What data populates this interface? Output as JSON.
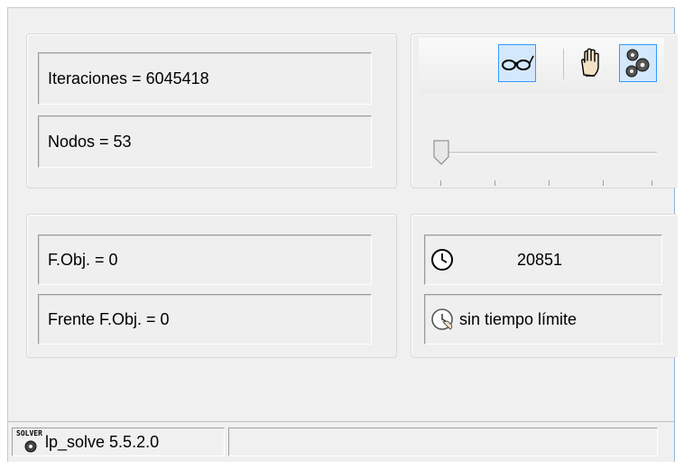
{
  "stats": {
    "iterations": "Iteraciones = 6045418",
    "nodes": "Nodos = 53"
  },
  "objective": {
    "fobj": "F.Obj. = 0",
    "frente_fobj": "Frente F.Obj. = 0"
  },
  "toolbar": {
    "buttons": [
      {
        "icon": "glasses-icon",
        "active": true
      },
      {
        "icon": "hand-icon",
        "active": false
      },
      {
        "icon": "gears-icon",
        "active": true
      }
    ]
  },
  "slider": {
    "level": 0.0,
    "ticks": 5
  },
  "timer": {
    "elapsed": "20851",
    "limit": "sin tiempo límite"
  },
  "status": {
    "logo_text": "SOLVER",
    "app_name": "lp_solve 5.5.2.0",
    "message": ""
  },
  "colors": {
    "active_border": "#3399ff",
    "active_bg": "#d4e8fb"
  }
}
